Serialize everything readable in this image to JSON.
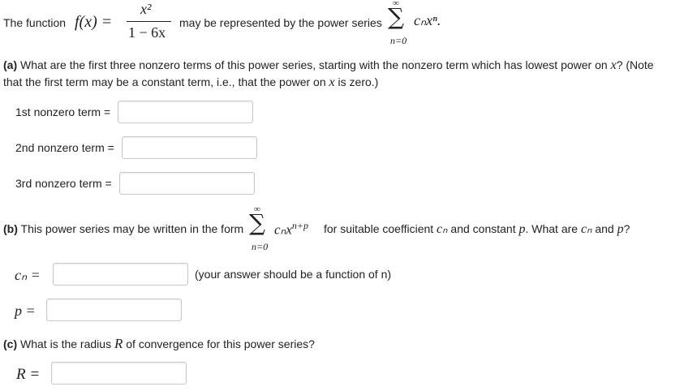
{
  "intro": {
    "prefix": "The function",
    "func": "f(x) =",
    "numerator": "x²",
    "denominator": "1 − 6x",
    "middle": "may be represented by the power series",
    "sum_top": "∞",
    "sum_symbol": "∑",
    "sum_body": "cₙxⁿ.",
    "sum_bottom": "n=0"
  },
  "part_a": {
    "tag": "(a)",
    "q_line1_start": "What are the first three nonzero terms of this power series, starting with the nonzero term which has lowest power on",
    "q_var": "x",
    "q_line1_end": "? (Note",
    "q_line2_start": "that the first term may be a constant term, i.e., that the power on",
    "q_var2": "x",
    "q_line2_end": "is zero.)",
    "fields": [
      {
        "label": "1st nonzero term =",
        "value": ""
      },
      {
        "label": "2nd nonzero term =",
        "value": ""
      },
      {
        "label": "3rd nonzero term =",
        "value": ""
      }
    ]
  },
  "part_b": {
    "tag": "(b)",
    "q_start": "This power series may be written in the form",
    "sum_top": "∞",
    "sum_symbol": "∑",
    "sum_body": "cₙx",
    "sum_exp": "n+p",
    "sum_bottom": "n=0",
    "q_mid": "for suitable coefficient",
    "cn": "cₙ",
    "q_mid2": "and constant",
    "p": "p",
    "q_mid3": ". What are",
    "cn2": "cₙ",
    "q_and": "and",
    "p2": "p",
    "q_end": "?",
    "cn_label": "cₙ =",
    "cn_value": "",
    "cn_hint": "(your answer should be a function of n)",
    "p_label": "p =",
    "p_value": ""
  },
  "part_c": {
    "tag": "(c)",
    "q_start": "What is the radius",
    "R": "R",
    "q_end": "of convergence for this power series?",
    "R_label": "R =",
    "R_value": ""
  }
}
